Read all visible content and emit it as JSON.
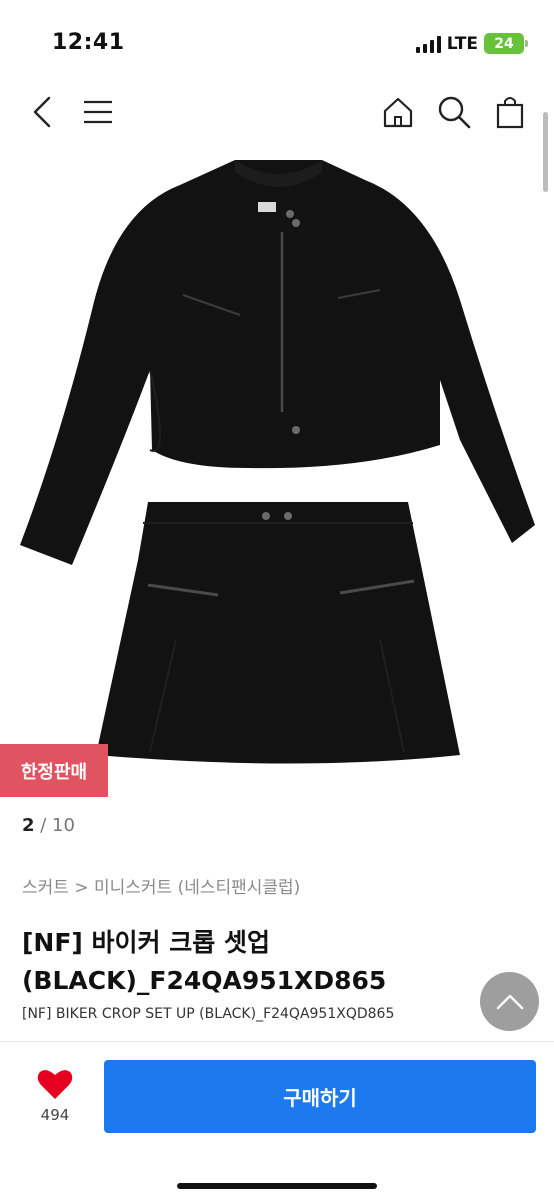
{
  "status_bar": {
    "time": "12:41",
    "network": "LTE",
    "battery": "24"
  },
  "nav": {
    "icons": [
      "back-icon",
      "menu-icon",
      "home-icon",
      "search-icon",
      "shopping-bag-icon"
    ]
  },
  "product": {
    "badge": "한정판매",
    "image_index": "2",
    "image_total": "/ 10",
    "breadcrumb": "스커트 > 미니스커트 (네스티팬시클럽)",
    "title": "[NF] 바이커 크롭 셋업 (BLACK)_F24QA951XD865",
    "subtitle": "[NF] BIKER CROP SET UP (BLACK)_F24QA951XQD865"
  },
  "actions": {
    "like_count": "494",
    "buy_label": "구매하기"
  },
  "colors": {
    "accent": "#1d79ee",
    "badge": "#e05461",
    "heart": "#e5001f"
  }
}
